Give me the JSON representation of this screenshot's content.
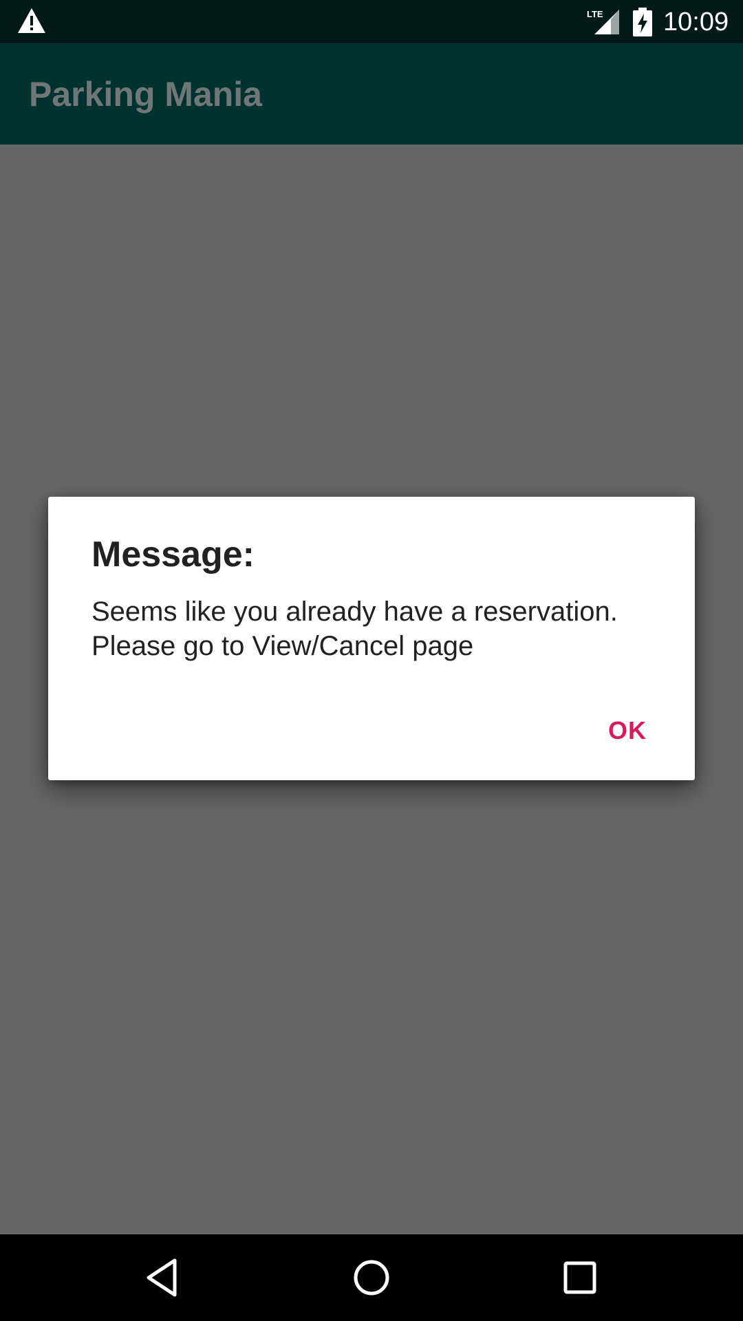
{
  "status_bar": {
    "time": "10:09",
    "network_label": "LTE",
    "icons": [
      "alert-icon",
      "signal-icon",
      "battery-charging-icon"
    ]
  },
  "app_bar": {
    "title": "Parking Mania"
  },
  "dialog": {
    "title": "Message:",
    "message": "Seems like you already have a reservation. Please go to View/Cancel page",
    "ok_label": "OK"
  },
  "nav_bar": {
    "icons": [
      "back-icon",
      "home-icon",
      "recents-icon"
    ]
  },
  "colors": {
    "status_bar": "#031a19",
    "app_bar": "#023230",
    "scrim": "#666666",
    "accent": "#d81b60",
    "dialog_text": "#212121"
  }
}
